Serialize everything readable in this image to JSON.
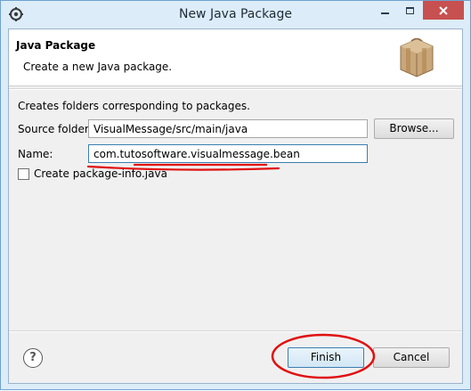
{
  "window": {
    "title": "New Java Package",
    "colors": {
      "close_button": "#c75050",
      "frame": "#dcecf8",
      "annotation": "#e01010"
    }
  },
  "titlebar": {
    "app_icon": "eclipse-gear-icon",
    "minimize_icon": "minimize-icon",
    "maximize_icon": "maximize-icon",
    "close_icon": "close-icon"
  },
  "banner": {
    "title": "Java Package",
    "description": "Create a new Java package.",
    "icon": "package-box-icon"
  },
  "form": {
    "info": "Creates folders corresponding to packages.",
    "source_folder_label": "Source folder:",
    "source_folder_value": "VisualMessage/src/main/java",
    "browse_label": "Browse...",
    "name_label": "Name:",
    "name_value": "com.tutosoftware.visualmessage.bean",
    "package_info_label": "Create package-info.java",
    "package_info_checked": false
  },
  "footer": {
    "help_icon": "help-icon",
    "help_glyph": "?",
    "finish_label": "Finish",
    "cancel_label": "Cancel"
  }
}
